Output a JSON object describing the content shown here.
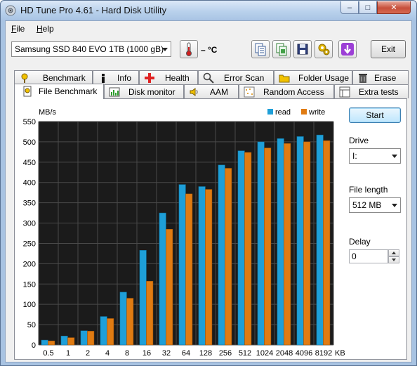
{
  "window": {
    "title": "HD Tune Pro 4.61 - Hard Disk Utility",
    "minimize_glyph": "–",
    "maximize_glyph": "□",
    "close_glyph": "✕"
  },
  "menu": [
    {
      "label": "File",
      "accel": "F",
      "rest": "ile"
    },
    {
      "label": "Help",
      "accel": "H",
      "rest": "elp"
    }
  ],
  "toolbar": {
    "drive_selected": "Samsung SSD 840 EVO 1TB (1000 gB)",
    "temperature": "– °C",
    "exit_label": "Exit",
    "icons": [
      "copy-icon",
      "copy-screenshot-icon",
      "save-icon",
      "options-icon",
      "download-icon"
    ]
  },
  "tabs_top": [
    {
      "label": "Benchmark",
      "icon": "benchmark-icon"
    },
    {
      "label": "Info",
      "icon": "info-icon"
    },
    {
      "label": "Health",
      "icon": "health-icon"
    },
    {
      "label": "Error Scan",
      "icon": "error-scan-icon"
    },
    {
      "label": "Folder Usage",
      "icon": "folder-icon"
    },
    {
      "label": "Erase",
      "icon": "erase-icon"
    }
  ],
  "tabs_bottom": [
    {
      "label": "File Benchmark",
      "icon": "file-benchmark-icon",
      "active": true
    },
    {
      "label": "Disk monitor",
      "icon": "disk-monitor-icon"
    },
    {
      "label": "AAM",
      "icon": "speaker-icon"
    },
    {
      "label": "Random Access",
      "icon": "random-access-icon"
    },
    {
      "label": "Extra tests",
      "icon": "extra-tests-icon"
    }
  ],
  "side": {
    "start_label": "Start",
    "drive_label": "Drive",
    "drive_value": "I:",
    "file_length_label": "File length",
    "file_length_value": "512 MB",
    "delay_label": "Delay",
    "delay_value": "0"
  },
  "chart_data": {
    "type": "bar",
    "ylabel": "MB/s",
    "xunit": "KB",
    "ylim": [
      0,
      550
    ],
    "yticks": [
      0,
      50,
      100,
      150,
      200,
      250,
      300,
      350,
      400,
      450,
      500,
      550
    ],
    "grid": true,
    "legend_position": "top-right",
    "categories": [
      "0.5",
      "1",
      "2",
      "4",
      "8",
      "16",
      "32",
      "64",
      "128",
      "256",
      "512",
      "1024",
      "2048",
      "4096",
      "8192"
    ],
    "series": [
      {
        "name": "read",
        "color": "#1e9fd8",
        "values": [
          12,
          22,
          35,
          70,
          130,
          233,
          325,
          395,
          390,
          443,
          478,
          500,
          508,
          513,
          517
        ]
      },
      {
        "name": "write",
        "color": "#e07b12",
        "values": [
          10,
          18,
          34,
          65,
          115,
          157,
          285,
          372,
          383,
          435,
          474,
          485,
          496,
          500,
          503
        ]
      }
    ]
  }
}
